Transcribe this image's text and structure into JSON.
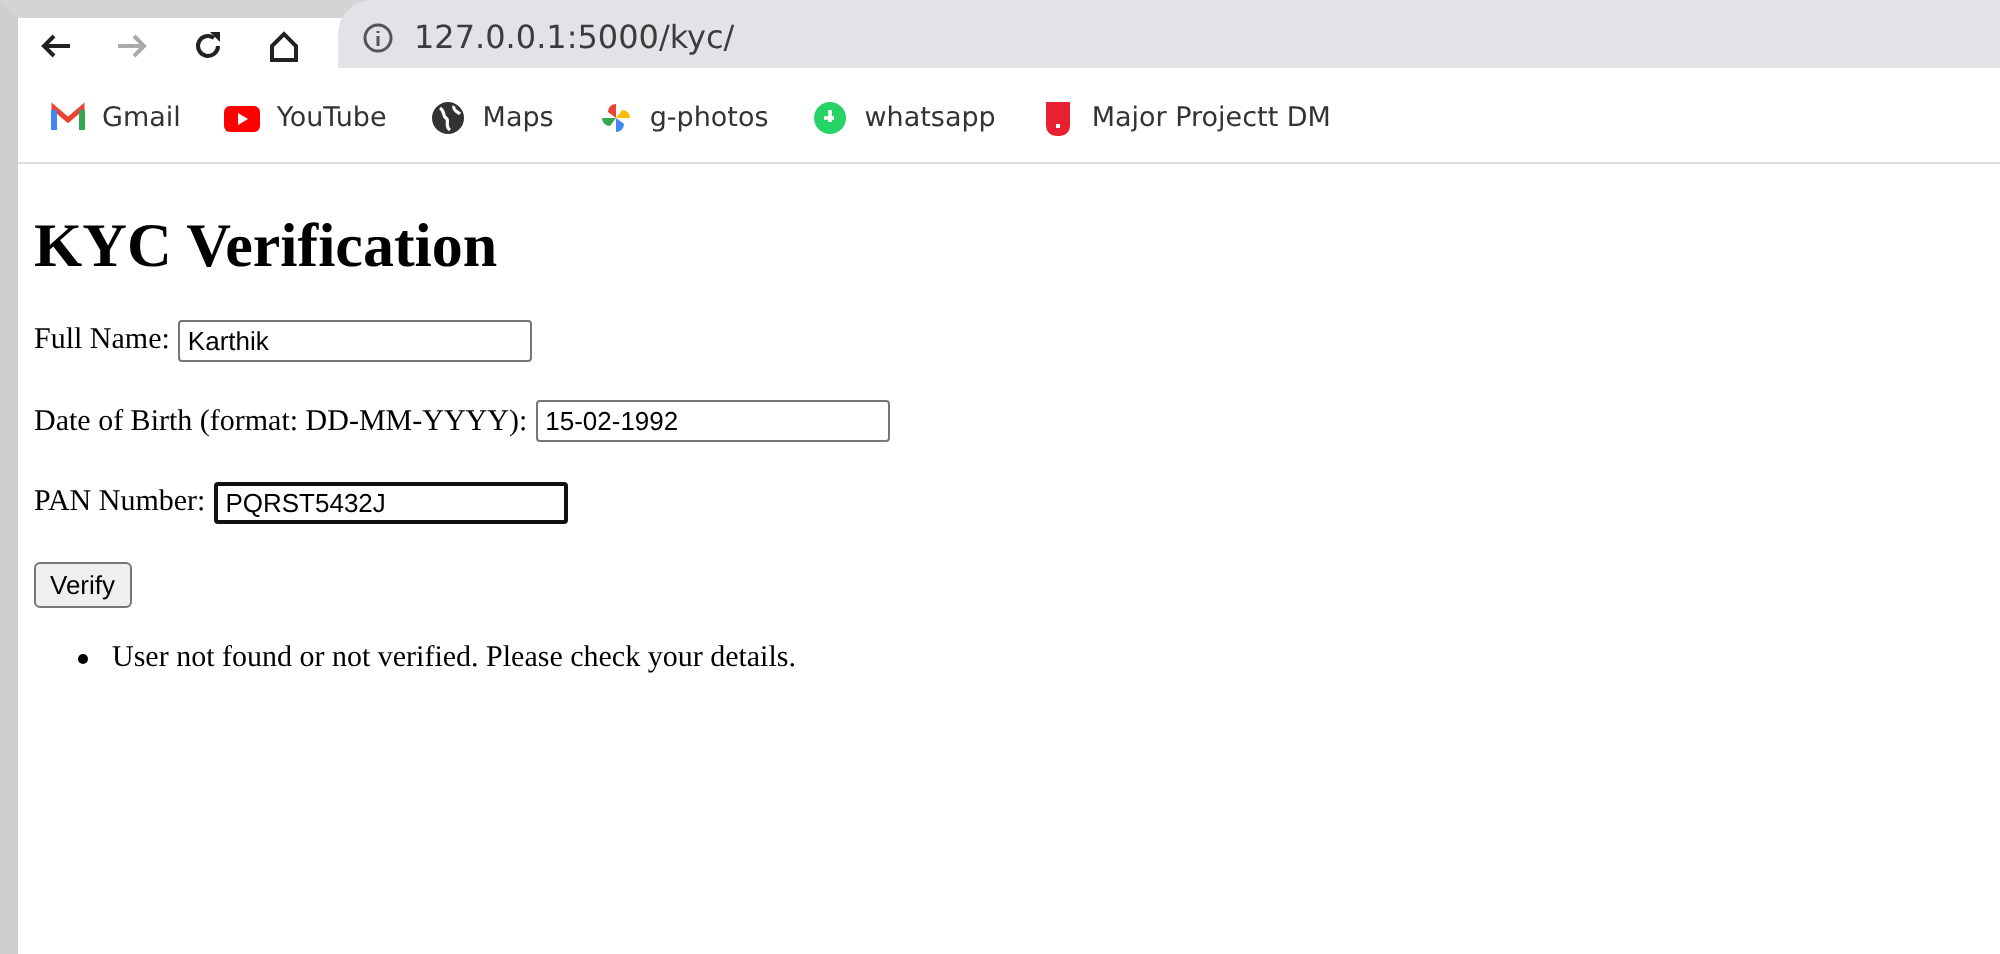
{
  "browser": {
    "url": "127.0.0.1:5000/kyc/",
    "bookmarks": [
      {
        "label": "Gmail",
        "kind": "mail"
      },
      {
        "label": "YouTube",
        "kind": "video"
      },
      {
        "label": "Maps",
        "kind": "globe"
      },
      {
        "label": "g-photos",
        "kind": "pinwheel"
      },
      {
        "label": "whatsapp",
        "kind": "chat"
      },
      {
        "label": "Major Projectt DM",
        "kind": "bookmark"
      }
    ]
  },
  "page": {
    "title": "KYC Verification",
    "fields": [
      {
        "label": "Full Name:",
        "value": "Karthik",
        "focused": false
      },
      {
        "label": "Date of Birth (format: DD-MM-YYYY):",
        "value": "15-02-1992",
        "focused": false
      },
      {
        "label": "PAN Number:",
        "value": "PQRST5432J",
        "focused": true
      }
    ],
    "button": "Verify",
    "messages": [
      "User not found or not verified. Please check your details."
    ]
  }
}
